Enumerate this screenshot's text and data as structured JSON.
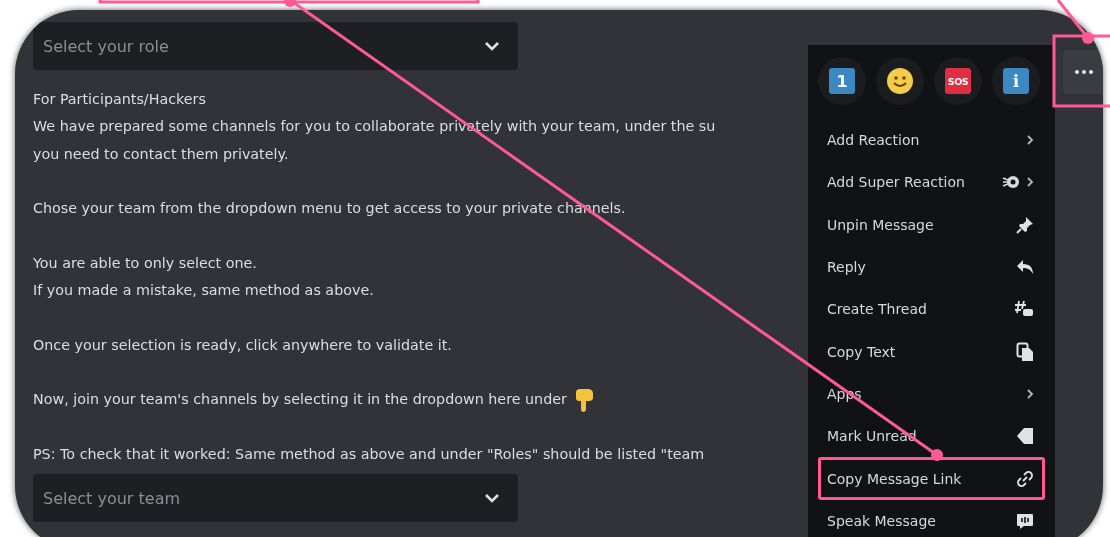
{
  "role_select": {
    "placeholder": "Select your role"
  },
  "message": {
    "paragraphs": [
      {
        "lines": [
          "For Participants/Hackers",
          "We have prepared some channels for you to collaborate privately with your team, under the su",
          "you need to contact them privately."
        ]
      },
      {
        "lines": [
          "Chose your team from the dropdown menu to get access to your private channels."
        ]
      },
      {
        "lines": [
          "You are able to only select one.",
          "If you made a mistake, same method as above."
        ]
      },
      {
        "lines": [
          "Once your selection is ready, click anywhere to validate it."
        ]
      },
      {
        "lines": [
          "Now, join your team's channels by selecting it in the dropdown here under"
        ],
        "kind": "pointing-hand"
      },
      {
        "lines": [
          "PS: To check that it worked: Same method as above and under \"Roles\" should be listed \"team"
        ]
      }
    ]
  },
  "team_select": {
    "placeholder": "Select your team"
  },
  "context_menu": {
    "reactions": [
      {
        "kind": "keycap",
        "label": "1"
      },
      {
        "kind": "smiley"
      },
      {
        "kind": "sos",
        "label": "SOS"
      },
      {
        "kind": "info",
        "label": "i"
      }
    ],
    "items": [
      {
        "label": "Add Reaction",
        "kind": "chevron",
        "highlighted": false
      },
      {
        "label": "Add Super Reaction",
        "kind": "super",
        "highlighted": false
      },
      {
        "label": "Unpin Message",
        "kind": "pin",
        "highlighted": false
      },
      {
        "label": "Reply",
        "kind": "reply",
        "highlighted": false
      },
      {
        "label": "Create Thread",
        "kind": "thread",
        "highlighted": false
      },
      {
        "label": "Copy Text",
        "kind": "copy",
        "highlighted": false
      },
      {
        "label": "Apps",
        "kind": "chevron",
        "highlighted": false
      },
      {
        "label": "Mark Unread",
        "kind": "tag",
        "highlighted": false
      },
      {
        "label": "Copy Message Link",
        "kind": "link",
        "highlighted": true
      },
      {
        "label": "Speak Message",
        "kind": "speaker",
        "highlighted": false
      }
    ]
  }
}
